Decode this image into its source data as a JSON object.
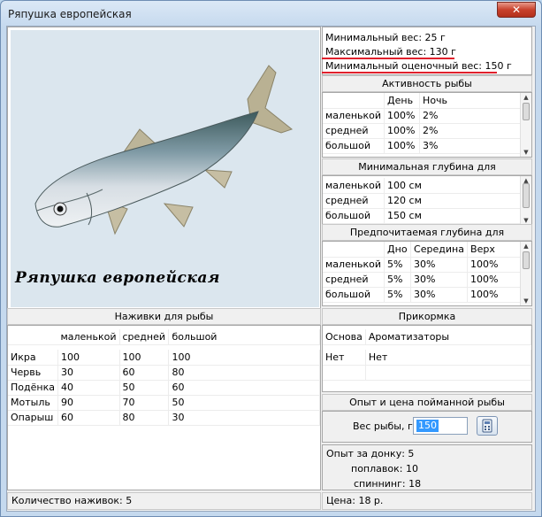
{
  "window": {
    "title": "Ряпушка европейская",
    "close_glyph": "✕"
  },
  "fish": {
    "name_caption": "Ряпушка европейская"
  },
  "weights": {
    "min": "Минимальный вес: 25 г",
    "max": "Максимальный вес: 130 г",
    "min_assessed": "Минимальный оценочный вес: 150 г"
  },
  "activity": {
    "title": "Активность рыбы",
    "columns": [
      "",
      "День",
      "Ночь"
    ],
    "rows": [
      [
        "маленькой",
        "100%",
        "2%"
      ],
      [
        "средней",
        "100%",
        "2%"
      ],
      [
        "большой",
        "100%",
        "3%"
      ]
    ]
  },
  "min_depth": {
    "title": "Минимальная глубина для",
    "rows": [
      [
        "маленькой",
        "100 см"
      ],
      [
        "средней",
        "120 см"
      ],
      [
        "большой",
        "150 см"
      ]
    ]
  },
  "pref_depth": {
    "title": "Предпочитаемая глубина для",
    "columns": [
      "",
      "Дно",
      "Середина",
      "Верх"
    ],
    "rows": [
      [
        "маленькой",
        "5%",
        "30%",
        "100%"
      ],
      [
        "средней",
        "5%",
        "30%",
        "100%"
      ],
      [
        "большой",
        "5%",
        "30%",
        "100%"
      ]
    ]
  },
  "baits": {
    "title": "Наживки для рыбы",
    "columns": [
      "",
      "маленькой",
      "средней",
      "большой"
    ],
    "rows": [
      [
        "Икра",
        "100",
        "100",
        "100"
      ],
      [
        "Червь",
        "30",
        "60",
        "80"
      ],
      [
        "Подёнка",
        "40",
        "50",
        "60"
      ],
      [
        "Мотыль",
        "90",
        "70",
        "50"
      ],
      [
        "Опарыш",
        "60",
        "80",
        "30"
      ]
    ],
    "count": "Количество наживок: 5"
  },
  "groundbait": {
    "title": "Прикормка",
    "columns": [
      "Основа",
      "Ароматизаторы"
    ],
    "values": [
      "Нет",
      "Нет"
    ]
  },
  "experience": {
    "title": "Опыт и цена пойманной рыбы",
    "weight_label": "Вес рыбы, г",
    "weight_value": "150",
    "bottom": "Опыт за донку: 5",
    "float": "поплавок: 10",
    "spinning": "спиннинг: 18",
    "price": "Цена: 18 р."
  },
  "colors": {
    "accent_red": "#e0202c",
    "selection": "#3399ff"
  }
}
